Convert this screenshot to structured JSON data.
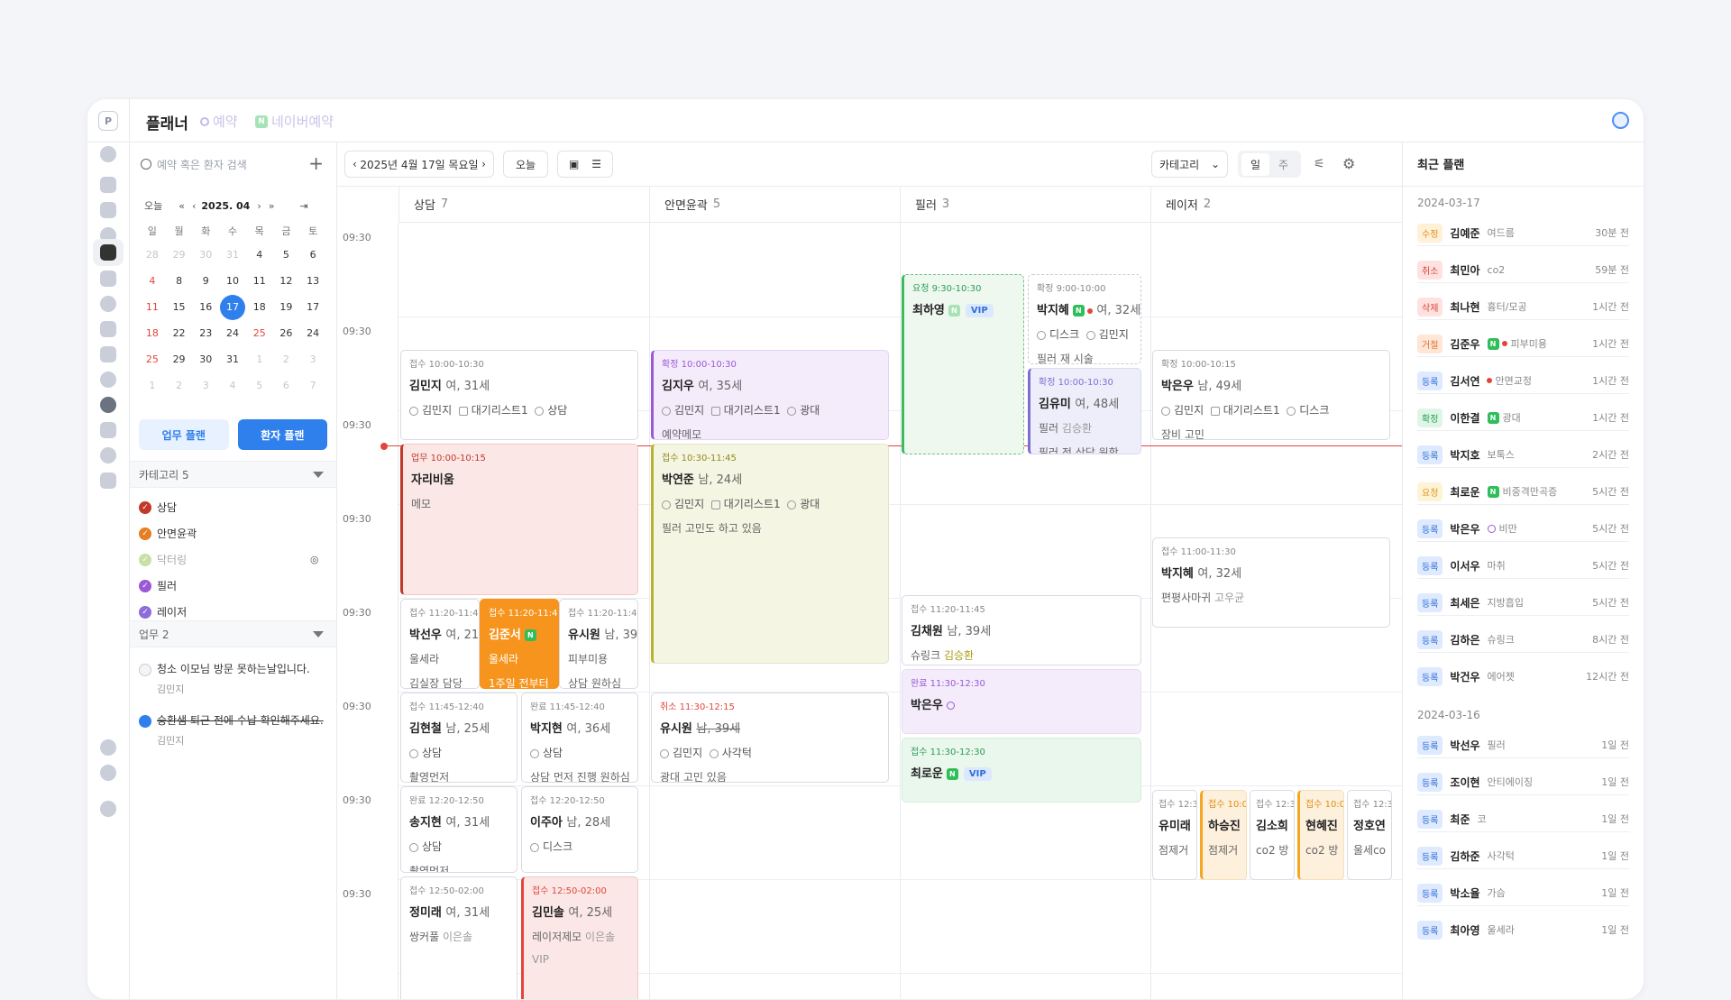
{
  "app": {
    "title": "플래너",
    "tag_booking": "예약",
    "tag_naver": "네이버예약",
    "logo": "P"
  },
  "search": {
    "placeholder": "예약 혹은 환자 검색"
  },
  "mini_cal": {
    "today": "오늘",
    "month": "2025. 04",
    "weekdays": [
      "일",
      "월",
      "화",
      "수",
      "목",
      "금",
      "토"
    ],
    "weeks": [
      [
        "28",
        "29",
        "30",
        "31",
        "4",
        "5",
        "6"
      ],
      [
        "4",
        "8",
        "9",
        "10",
        "11",
        "12",
        "13"
      ],
      [
        "11",
        "15",
        "16",
        "17",
        "18",
        "19",
        "17"
      ],
      [
        "18",
        "22",
        "23",
        "24",
        "25",
        "26",
        "24"
      ],
      [
        "25",
        "29",
        "30",
        "31",
        "1",
        "2",
        "3"
      ],
      [
        "1",
        "2",
        "3",
        "4",
        "5",
        "6",
        "7"
      ]
    ],
    "selected": "17"
  },
  "buttons": {
    "work_plan": "업무 플랜",
    "patient_plan": "환자 플랜"
  },
  "category": {
    "header": "카테고리 5",
    "items": [
      {
        "label": "상담",
        "color": "#c0392b",
        "on": true
      },
      {
        "label": "안면윤곽",
        "color": "#e67e22",
        "on": true
      },
      {
        "label": "닥터링",
        "color": "#c7e0a6",
        "on": false
      },
      {
        "label": "필러",
        "color": "#9b59d6",
        "on": true
      },
      {
        "label": "레이저",
        "color": "#8e6cd9",
        "on": true
      }
    ]
  },
  "work": {
    "header": "업무 2",
    "items": [
      {
        "text": "청소 이모님 방문 못하는날입니다.",
        "by": "김민지",
        "done": false
      },
      {
        "text": "승환샘 퇴근 전에 수납 확인해주세요.",
        "by": "김민지",
        "done": true
      }
    ]
  },
  "toolbar": {
    "date": "2025년 4월 17일 목요일",
    "today": "오늘",
    "category": "카테고리",
    "day": "일",
    "week": "주"
  },
  "columns": [
    {
      "name": "상담",
      "count": "7"
    },
    {
      "name": "안면윤곽",
      "count": "5"
    },
    {
      "name": "필러",
      "count": "3"
    },
    {
      "name": "레이저",
      "count": "2"
    }
  ],
  "time_labels": [
    "09:30",
    "09:30",
    "09:30",
    "09:30",
    "09:30",
    "09:30",
    "09:30",
    "09:30"
  ],
  "events": {
    "c1": {
      "st": "접수 10:00-10:30",
      "nm": "김민지",
      "meta": "여, 31세",
      "staff": "김민지",
      "room": "대기리스트1",
      "proc": "상담"
    },
    "c2": {
      "st": "업무 10:00-10:15",
      "nm": "자리비움",
      "memo": "메모"
    },
    "c3": {
      "st": "접수 11:20-11:45",
      "nm": "박선우",
      "meta": "여, 21세",
      "l1": "울세라",
      "l2": "김실장 담당"
    },
    "c4": {
      "st": "접수 11:20-11:45",
      "nm": "김준서",
      "l1": "울세라",
      "l2": "1주일 전부터"
    },
    "c5": {
      "st": "접수 11:20-11:45",
      "nm": "유시원",
      "meta": "남, 39",
      "l1": "피부미용",
      "l2": "상담 원하심"
    },
    "c6": {
      "st": "접수 11:45-12:40",
      "nm": "김현철",
      "meta": "남, 25세",
      "proc": "상담",
      "l2": "촬영먼저"
    },
    "c7": {
      "st": "완료 11:45-12:40",
      "nm": "박지현",
      "meta": "여, 36세",
      "proc": "상담",
      "l2": "상담 먼저 진행 원하심"
    },
    "c8": {
      "st": "완료 12:20-12:50",
      "nm": "송지현",
      "meta": "여, 31세",
      "proc": "상담",
      "l2": "촬영먼저"
    },
    "c9": {
      "st": "접수 12:20-12:50",
      "nm": "이주아",
      "meta": "남, 28세",
      "proc": "디스크"
    },
    "c10": {
      "st": "접수 12:50-02:00",
      "nm": "정미래",
      "meta": "여, 31세",
      "l1": "쌍커풀",
      "l1b": "이은솔"
    },
    "c11": {
      "st": "접수 12:50-02:00",
      "nm": "김민솔",
      "meta": "여, 25세",
      "l1": "레이저제모",
      "l1b": "이은솔",
      "l2": "VIP"
    },
    "a1": {
      "st": "확정 10:00-10:30",
      "nm": "김지우",
      "meta": "여, 35세",
      "staff": "김민지",
      "room": "대기리스트1",
      "proc": "광대",
      "memo": "예약메모"
    },
    "a2": {
      "st": "접수 10:30-11:45",
      "nm": "박연준",
      "meta": "남, 24세",
      "staff": "김민지",
      "room": "대기리스트1",
      "proc": "광대",
      "memo": "필러 고민도 하고 있음"
    },
    "a3": {
      "st": "취소 11:30-12:15",
      "nm": "유시원",
      "meta": "남, 39세",
      "staff": "김민지",
      "proc": "사각턱",
      "memo": "광대 고민 있음"
    },
    "f1": {
      "st": "요청 9:30-10:30",
      "nm": "최하영",
      "vip": "VIP"
    },
    "f2": {
      "st": "확정 9:00-10:00",
      "nm": "박지혜",
      "meta": "여, 32세",
      "proc": "디스크",
      "staff": "김민지",
      "memo": "필러 재 시술"
    },
    "f3": {
      "st": "확정 10:00-10:30",
      "nm": "김유미",
      "meta": "여, 48세",
      "l1": "필러",
      "l1b": "김승환",
      "memo": "필러 전 상담 원함"
    },
    "f4": {
      "st": "접수 11:20-11:45",
      "nm": "김채원",
      "meta": "남, 39세",
      "l1": "슈링크",
      "l1b": "김승환"
    },
    "f5": {
      "st": "완료 11:30-12:30",
      "nm": "박은우"
    },
    "f6": {
      "st": "접수 11:30-12:30",
      "nm": "최로운",
      "vip": "VIP"
    },
    "l1": {
      "st": "확정 10:00-10:15",
      "nm": "박은우",
      "meta": "남, 49세",
      "staff": "김민지",
      "room": "대기리스트1",
      "proc": "디스크",
      "memo": "장비 고민"
    },
    "l2": {
      "st": "접수 11:00-11:30",
      "nm": "박지혜",
      "meta": "여, 32세",
      "l1": "편평사마귀",
      "l1b": "고우균"
    },
    "l3": {
      "st": "접수 12:3",
      "nm": "유미래",
      "l1": "점제거"
    },
    "l4": {
      "st": "접수 10:0",
      "nm": "하승진",
      "l1": "점제거"
    },
    "l5": {
      "st": "접수 12:3",
      "nm": "김소희",
      "l1": "co2 방"
    },
    "l6": {
      "st": "접수 10:0",
      "nm": "현혜진",
      "l1": "co2 방"
    },
    "l7": {
      "st": "접수 12:3",
      "nm": "정호연",
      "l1": "울세co"
    }
  },
  "recent": {
    "title": "최근 플랜",
    "groups": [
      {
        "date": "2024-03-17",
        "items": [
          {
            "badge": "수정",
            "kind": "mod",
            "name": "김예준",
            "sub": "여드름",
            "time": "30분 전"
          },
          {
            "badge": "취소",
            "kind": "can",
            "name": "최민아",
            "sub": "co2",
            "time": "59분 전"
          },
          {
            "badge": "삭제",
            "kind": "del",
            "name": "최나현",
            "sub": "흉터/모공",
            "time": "1시간 전"
          },
          {
            "badge": "거절",
            "kind": "rej",
            "name": "김준우",
            "sub": "피부미용",
            "time": "1시간 전",
            "n": true,
            "dot": true
          },
          {
            "badge": "등록",
            "kind": "reg",
            "name": "김서연",
            "sub": "안면교정",
            "time": "1시간 전",
            "dot": true
          },
          {
            "badge": "확정",
            "kind": "cf",
            "name": "이한결",
            "sub": "광대",
            "time": "1시간 전",
            "n": true
          },
          {
            "badge": "등록",
            "kind": "reg",
            "name": "박지호",
            "sub": "보톡스",
            "time": "2시간 전"
          },
          {
            "badge": "요청",
            "kind": "req",
            "name": "최로운",
            "sub": "비중격만곡증",
            "time": "5시간 전",
            "n": true
          },
          {
            "badge": "등록",
            "kind": "reg",
            "name": "박은우",
            "sub": "비만",
            "time": "5시간 전",
            "p": true
          },
          {
            "badge": "등록",
            "kind": "reg",
            "name": "이서우",
            "sub": "마취",
            "time": "5시간 전"
          },
          {
            "badge": "등록",
            "kind": "reg",
            "name": "최세은",
            "sub": "지방흡입",
            "time": "5시간 전"
          },
          {
            "badge": "등록",
            "kind": "reg",
            "name": "김하은",
            "sub": "슈링크",
            "time": "8시간 전"
          },
          {
            "badge": "등록",
            "kind": "reg",
            "name": "박건우",
            "sub": "에어젯",
            "time": "12시간 전"
          }
        ]
      },
      {
        "date": "2024-03-16",
        "items": [
          {
            "badge": "등록",
            "kind": "reg",
            "name": "박선우",
            "sub": "필러",
            "time": "1일 전"
          },
          {
            "badge": "등록",
            "kind": "reg",
            "name": "조이현",
            "sub": "안티에이징",
            "time": "1일 전"
          },
          {
            "badge": "등록",
            "kind": "reg",
            "name": "최준",
            "sub": "코",
            "time": "1일 전"
          },
          {
            "badge": "등록",
            "kind": "reg",
            "name": "김하준",
            "sub": "사각턱",
            "time": "1일 전"
          },
          {
            "badge": "등록",
            "kind": "reg",
            "name": "박소율",
            "sub": "가슴",
            "time": "1일 전"
          },
          {
            "badge": "등록",
            "kind": "reg",
            "name": "최아영",
            "sub": "울세라",
            "time": "1일 전"
          }
        ]
      }
    ]
  },
  "colors": {
    "accent": "#2f80ed",
    "now": "#e2453c"
  }
}
